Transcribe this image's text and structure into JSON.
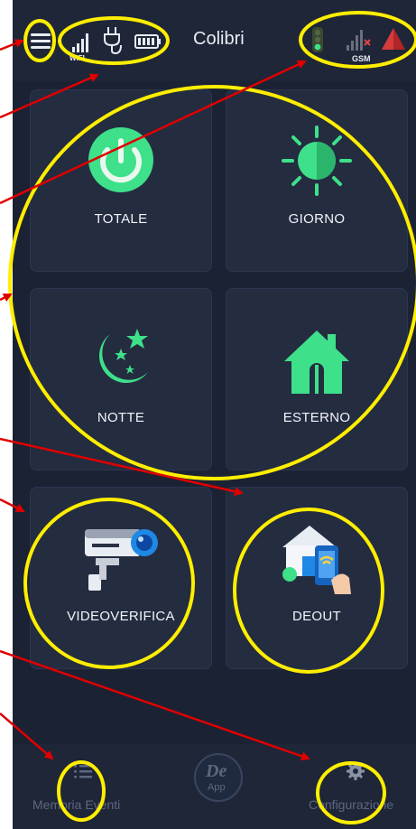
{
  "header": {
    "title": "Colibri",
    "wifi_label": "WIFI",
    "gsm_label": "GSM"
  },
  "tiles": [
    {
      "label": "TOTALE",
      "icon": "power-icon"
    },
    {
      "label": "GIORNO",
      "icon": "sun-icon"
    },
    {
      "label": "NOTTE",
      "icon": "moon-stars-icon"
    },
    {
      "label": "ESTERNO",
      "icon": "house-icon"
    },
    {
      "label": "VIDEOVERIFICA",
      "icon": "security-camera-icon"
    },
    {
      "label": "DEOUT",
      "icon": "house-phone-icon"
    }
  ],
  "bottom_nav": {
    "left_label": "Memoria Eventi",
    "center_logo_top": "De",
    "center_logo_bottom": "App",
    "right_label": "Configurazione"
  },
  "colors": {
    "background": "#1b2233",
    "tile": "#242c40",
    "accent_green": "#3ee08a",
    "alarm_red": "#e04545",
    "annotation_yellow": "#ffee00",
    "annotation_red": "#e00000"
  }
}
